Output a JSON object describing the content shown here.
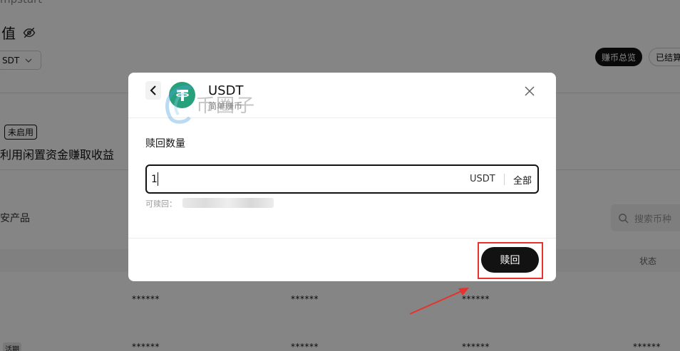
{
  "background": {
    "app_name": "mpstart",
    "page_title": "值",
    "currency_select": "SDT",
    "pill_overview": "赚币总览",
    "pill_settled": "已结算",
    "status_badge": "未启用",
    "promo_text": "利用闲置资金赚取收益",
    "section_label": "安产品",
    "search_placeholder": "搜索币种",
    "table_status_header": "状态",
    "masked_value": "******",
    "row_badge": "活期"
  },
  "modal": {
    "coin_name": "USDT",
    "coin_subtitle": "简单赚币",
    "field_label": "赎回数量",
    "amount_value": "1",
    "unit": "USDT",
    "all_label": "全部",
    "available_label": "可赎回：",
    "redeem_label": "赎回"
  },
  "watermark_text": "币圈子",
  "colors": {
    "usdt_green": "#26a17b",
    "primary_dark": "#121212",
    "annotation_red": "#e8312c"
  },
  "icons": [
    "eye-off-icon",
    "chevron-down-icon",
    "back-chevron-icon",
    "tether-icon",
    "close-icon",
    "search-icon"
  ]
}
